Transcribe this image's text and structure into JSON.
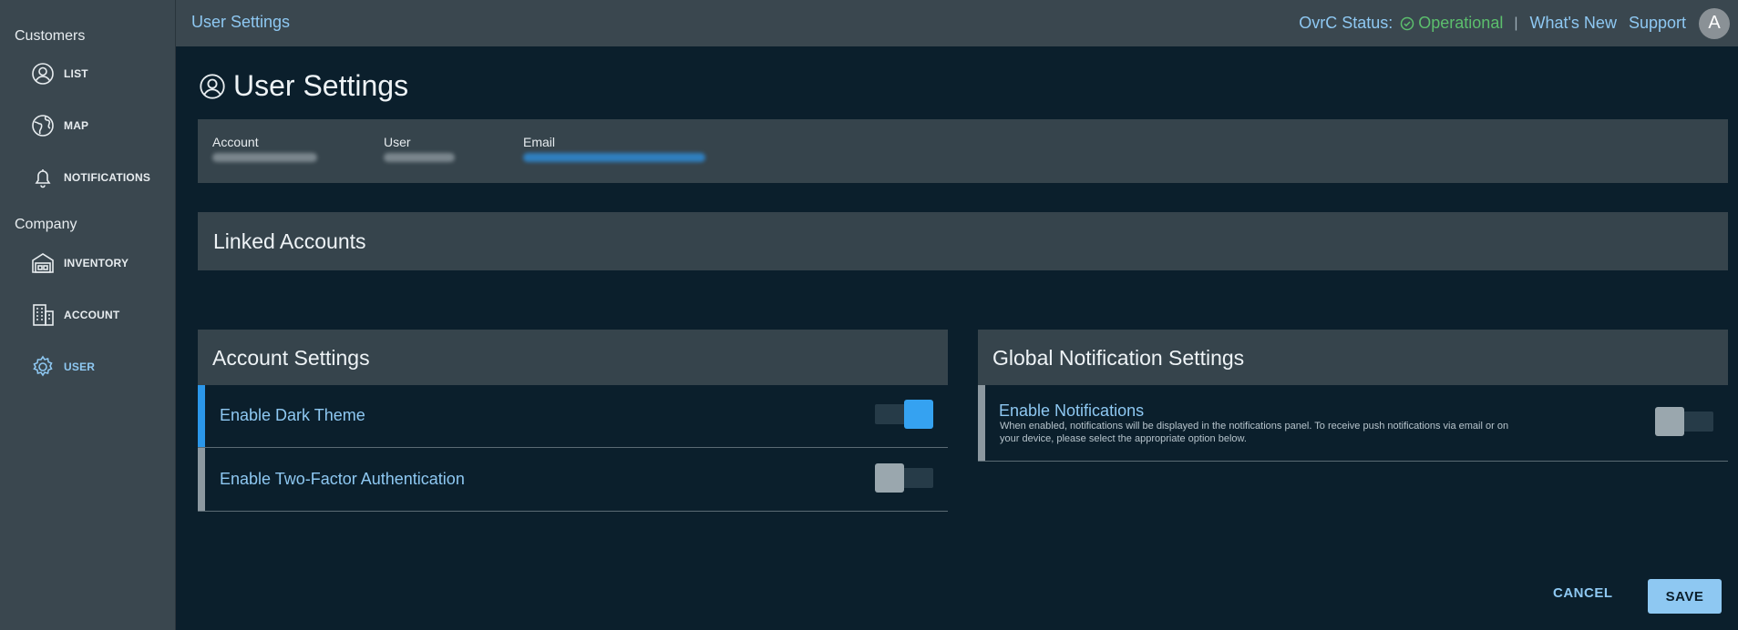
{
  "sidebar": {
    "customers_title": "Customers",
    "company_title": "Company",
    "items": [
      {
        "label": "LIST",
        "icon": "user-circle-icon"
      },
      {
        "label": "MAP",
        "icon": "globe-icon"
      },
      {
        "label": "NOTIFICATIONS",
        "icon": "bell-icon"
      },
      {
        "label": "INVENTORY",
        "icon": "warehouse-icon"
      },
      {
        "label": "ACCOUNT",
        "icon": "building-icon"
      },
      {
        "label": "USER",
        "icon": "gear-icon"
      }
    ],
    "active_item": "USER"
  },
  "header": {
    "title": "User Settings",
    "status_label": "OvrC Status:",
    "status_value": "Operational",
    "separator": "|",
    "whats_new": "What's New",
    "support": "Support",
    "avatar_initial": "A"
  },
  "page": {
    "title": "User Settings",
    "info": {
      "account_label": "Account",
      "user_label": "User",
      "email_label": "Email"
    },
    "linked_accounts_title": "Linked Accounts",
    "account_settings": {
      "title": "Account Settings",
      "rows": [
        {
          "label": "Enable Dark Theme",
          "enabled": true
        },
        {
          "label": "Enable Two-Factor Authentication",
          "enabled": false
        }
      ]
    },
    "global_notifications": {
      "title": "Global Notification Settings",
      "row": {
        "label": "Enable Notifications",
        "description": "When enabled, notifications will be displayed in the notifications panel. To receive push notifications via email or on your device, please select the appropriate option below.",
        "enabled": false
      }
    },
    "buttons": {
      "cancel": "CANCEL",
      "save": "SAVE"
    }
  },
  "colors": {
    "background": "#0b1f2c",
    "panel": "#36444c",
    "accent": "#8ec8f2",
    "toggle_on": "#35a2f1",
    "status_ok": "#5cbf6d"
  }
}
